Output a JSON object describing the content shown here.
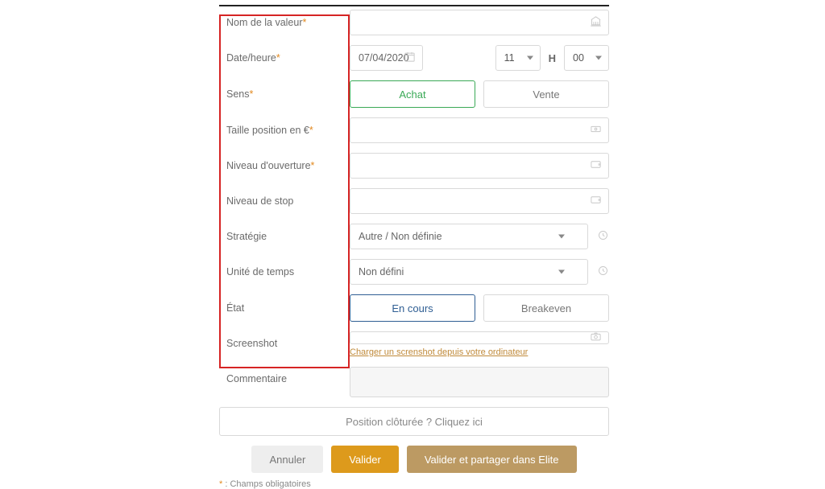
{
  "labels": {
    "value_name": "Nom de la valeur",
    "datetime": "Date/heure",
    "direction": "Sens",
    "position_size": "Taille position en €",
    "open_level": "Niveau d'ouverture",
    "stop_level": "Niveau de stop",
    "strategy": "Stratégie",
    "timeframe": "Unité de temps",
    "state": "État",
    "screenshot": "Screenshot",
    "comment": "Commentaire"
  },
  "fields": {
    "date": "07/04/2020",
    "hour": "11",
    "hm_sep": "H",
    "minute": "00",
    "direction_buy": "Achat",
    "direction_sell": "Vente",
    "strategy_value": "Autre / Non définie",
    "timeframe_value": "Non défini",
    "state_ongoing": "En cours",
    "state_breakeven": "Breakeven",
    "screenshot_link": "Charger un screnshot depuis votre ordinateur"
  },
  "closed_bar": "Position clôturée ? Cliquez ici",
  "actions": {
    "cancel": "Annuler",
    "validate": "Valider",
    "validate_elite": "Valider et partager dans Elite"
  },
  "footnote": {
    "star": "*",
    "sep": " : ",
    "text": "Champs obligatoires"
  },
  "required_marker": "*"
}
